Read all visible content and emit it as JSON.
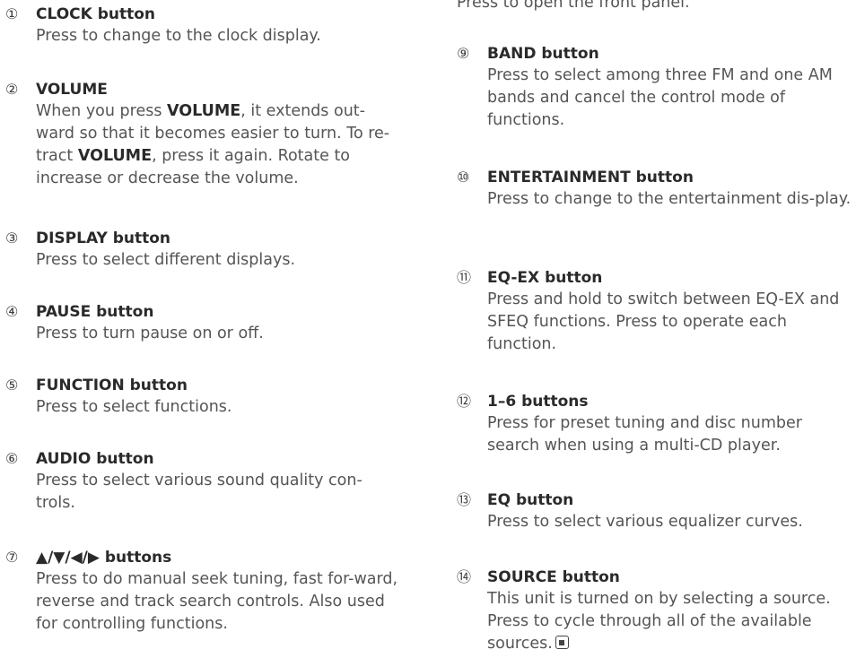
{
  "left_items": [
    {
      "num": "①",
      "title": "CLOCK button",
      "desc": "Press to change to the clock display."
    },
    {
      "num": "②",
      "title": "VOLUME",
      "desc_parts": [
        "When you press ",
        "VOLUME",
        ", it extends out-ward so that it becomes easier to turn. To re-tract ",
        "VOLUME",
        ", press it again. Rotate to increase or decrease the volume."
      ]
    },
    {
      "num": "③",
      "title": "DISPLAY button",
      "desc": "Press to select different displays."
    },
    {
      "num": "④",
      "title": "PAUSE button",
      "desc": "Press to turn pause on or off."
    },
    {
      "num": "⑤",
      "title": "FUNCTION button",
      "desc": "Press to select functions."
    },
    {
      "num": "⑥",
      "title": "AUDIO button",
      "desc": "Press to select various sound quality con-trols."
    },
    {
      "num": "⑦",
      "title": "▲/▼/◀/▶ buttons",
      "desc": "Press to do manual seek tuning, fast for-ward, reverse and track search controls. Also used for controlling functions."
    }
  ],
  "right_top_text": "Press to open the front panel.",
  "right_items": [
    {
      "num": "⑨",
      "title": "BAND button",
      "desc": "Press to select among three FM and one AM bands and cancel the control mode of functions."
    },
    {
      "num": "⑩",
      "title": "ENTERTAINMENT button",
      "desc": "Press to change to the entertainment dis-play."
    },
    {
      "num": "⑪",
      "title": "EQ-EX button",
      "desc": "Press and hold to switch between EQ-EX and SFEQ functions. Press to operate each function."
    },
    {
      "num": "⑫",
      "title": "1–6 buttons",
      "desc": "Press for preset tuning and disc number search when using a multi-CD player."
    },
    {
      "num": "⑬",
      "title": "EQ button",
      "desc": "Press to select various equalizer curves."
    },
    {
      "num": "⑭",
      "title": "SOURCE button",
      "desc": "This unit is turned on by selecting a source. Press to cycle through all of the available sources."
    }
  ],
  "icons": {
    "end_mark": "stop-square-icon"
  }
}
